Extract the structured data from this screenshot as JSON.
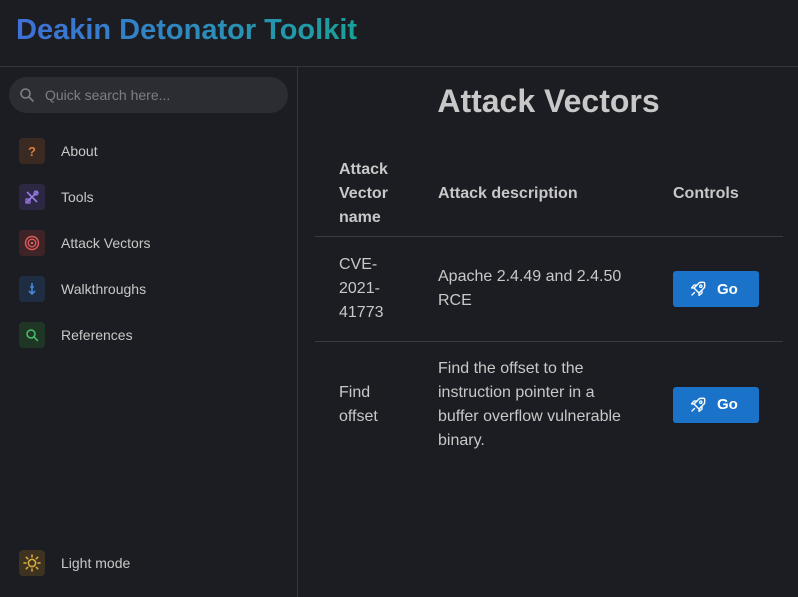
{
  "app": {
    "title": "Deakin Detonator Toolkit"
  },
  "search": {
    "placeholder": "Quick search here..."
  },
  "sidebar": {
    "items": [
      {
        "label": "About",
        "icon": "question-icon",
        "color": "#e07a3a"
      },
      {
        "label": "Tools",
        "icon": "tools-icon",
        "color": "#9a7ae6"
      },
      {
        "label": "Attack Vectors",
        "icon": "target-icon",
        "color": "#e05a5a"
      },
      {
        "label": "Walkthroughs",
        "icon": "arrow-down-icon",
        "color": "#4a8fe0"
      },
      {
        "label": "References",
        "icon": "search-icon",
        "color": "#4ac06a"
      }
    ],
    "theme_toggle": {
      "label": "Light mode",
      "icon": "sun-icon",
      "color": "#e0b040"
    }
  },
  "main": {
    "title": "Attack Vectors",
    "table": {
      "headers": [
        "Attack Vector name",
        "Attack description",
        "Controls"
      ],
      "rows": [
        {
          "name": "CVE-2021-41773",
          "description": "Apache 2.4.49 and 2.4.50 RCE",
          "button": "Go"
        },
        {
          "name": "Find offset",
          "description": "Find the offset to the instruction pointer in a buffer overflow vulnerable binary.",
          "button": "Go"
        }
      ]
    }
  },
  "colors": {
    "accent": "#1a73c8",
    "background": "#1c1d22"
  }
}
